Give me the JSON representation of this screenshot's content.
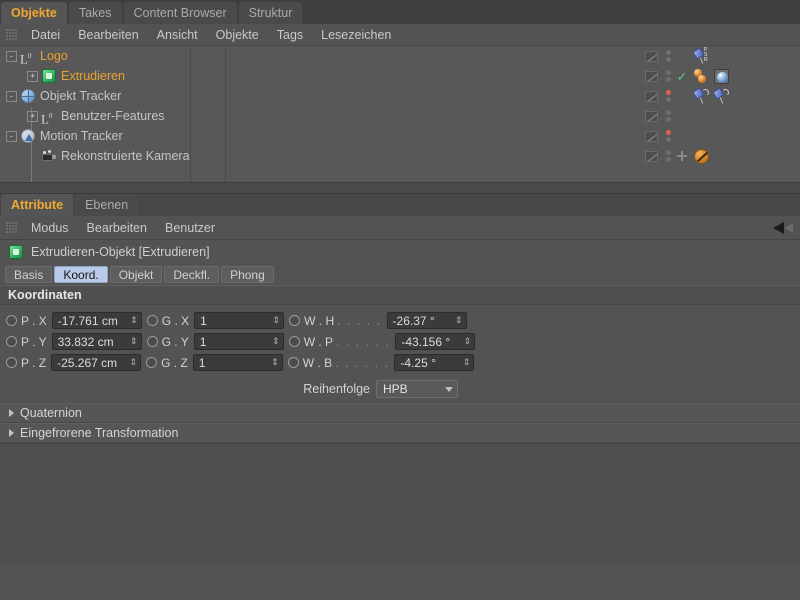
{
  "top_tabs": [
    {
      "label": "Objekte",
      "active": true
    },
    {
      "label": "Takes",
      "active": false
    },
    {
      "label": "Content Browser",
      "active": false
    },
    {
      "label": "Struktur",
      "active": false
    }
  ],
  "object_menu": [
    "Datei",
    "Bearbeiten",
    "Ansicht",
    "Objekte",
    "Tags",
    "Lesezeichen"
  ],
  "object_tree": [
    {
      "label": "Logo",
      "icon": "null-object-icon",
      "highlight": true,
      "depth": 0,
      "expander": "-",
      "dots": [
        "grey",
        "grey"
      ],
      "mark": "none",
      "tags": [
        "psr-pin-tag"
      ]
    },
    {
      "label": "Extrudieren",
      "icon": "extrude-object-icon",
      "highlight": true,
      "depth": 1,
      "expander": "+",
      "dots": [
        "grey",
        "grey"
      ],
      "mark": "check",
      "tags": [
        "ball-tag",
        "material-tag"
      ]
    },
    {
      "label": "Objekt Tracker",
      "icon": "object-tracker-icon",
      "highlight": false,
      "depth": 0,
      "expander": "-",
      "dots": [
        "red",
        "grey"
      ],
      "mark": "none",
      "tags": [
        "pin-arc-tag",
        "pin-arc-tag"
      ]
    },
    {
      "label": "Benutzer-Features",
      "icon": "null-object-icon",
      "highlight": false,
      "depth": 1,
      "expander": "+",
      "dots": [
        "grey",
        "grey"
      ],
      "mark": "none",
      "tags": []
    },
    {
      "label": "Motion Tracker",
      "icon": "motion-tracker-icon",
      "highlight": false,
      "depth": 0,
      "expander": "-",
      "dots": [
        "red",
        "grey"
      ],
      "mark": "none",
      "tags": []
    },
    {
      "label": "Rekonstruierte Kamera",
      "icon": "camera-icon",
      "highlight": false,
      "depth": 1,
      "expander": "",
      "dots": [
        "grey",
        "grey"
      ],
      "mark": "cross",
      "tags": [
        "prohibited-tag"
      ]
    }
  ],
  "attribute_tabs": [
    {
      "label": "Attribute",
      "active": true
    },
    {
      "label": "Ebenen",
      "active": false
    }
  ],
  "attribute_menu": [
    "Modus",
    "Bearbeiten",
    "Benutzer"
  ],
  "object_title": "Extrudieren-Objekt [Extrudieren]",
  "mode_tabs": [
    {
      "label": "Basis",
      "active": false
    },
    {
      "label": "Koord.",
      "active": true
    },
    {
      "label": "Objekt",
      "active": false
    },
    {
      "label": "Deckfl.",
      "active": false
    },
    {
      "label": "Phong",
      "active": false
    }
  ],
  "coordinates": {
    "header": "Koordinaten",
    "rows": [
      {
        "p_label": "P . X",
        "p_value": "-17.761 cm",
        "g_label": "G . X",
        "g_value": "1",
        "w_label": "W . H",
        "w_dots": ". . . . .",
        "w_value": "-26.37 °"
      },
      {
        "p_label": "P . Y",
        "p_value": "33.832 cm",
        "g_label": "G . Y",
        "g_value": "1",
        "w_label": "W . P",
        "w_dots": ". . . . . .",
        "w_value": "-43.156 °"
      },
      {
        "p_label": "P . Z",
        "p_value": "-25.267 cm",
        "g_label": "G . Z",
        "g_value": "1",
        "w_label": "W . B",
        "w_dots": ". . . . . .",
        "w_value": "-4.25 °"
      }
    ],
    "order_label": "Reihenfolge",
    "order_value": "HPB"
  },
  "sections": [
    {
      "label": "Quaternion"
    },
    {
      "label": "Eingefrorene Transformation"
    }
  ],
  "colors": {
    "accent_orange": "#e8a22e",
    "active_tab_text": "#f0a830",
    "panel_bg": "#535353",
    "tree_bg": "#585858",
    "field_bg": "#3b3b3b",
    "mode_tab_active_bg": "#b9c9e8",
    "check_green": "#4fd18a",
    "dot_red": "#e2615c"
  }
}
